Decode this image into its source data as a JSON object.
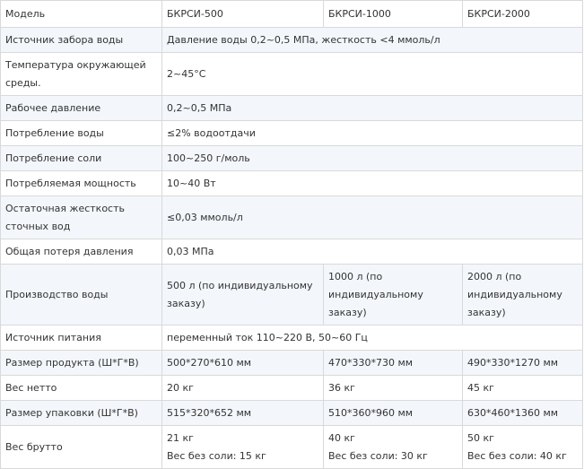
{
  "header": {
    "label": "Модель",
    "models": [
      "БКРСИ-500",
      "БКРСИ-1000",
      "БКРСИ-2000"
    ]
  },
  "rows": {
    "water_source": {
      "label": "Источник забора воды",
      "value": "Давление воды 0,2~0,5 МПа, жесткость <4 ммоль/л"
    },
    "ambient_temp": {
      "label": "Температура окружающей среды.",
      "value": "2~45°C"
    },
    "working_pressure": {
      "label": "Рабочее давление",
      "value": "0,2~0,5 МПа"
    },
    "water_consumption": {
      "label": "Потребление воды",
      "value": "≤2% водоотдачи"
    },
    "salt_consumption": {
      "label": "Потребление соли",
      "value": "100~250 г/моль"
    },
    "power_consumption": {
      "label": "Потребляемая мощность",
      "value": "10~40 Вт"
    },
    "residual_hardness": {
      "label": "Остаточная жесткость сточных вод",
      "value": "≤0,03 ммоль/л"
    },
    "pressure_loss": {
      "label": "Общая потеря давления",
      "value": "0,03 МПа"
    },
    "productivity": {
      "label": "Производство воды",
      "values": [
        "500 л (по индивидуальному заказу)",
        "1000 л (по индивидуальному заказу)",
        "2000 л (по индивидуальному заказу)"
      ]
    },
    "power_supply": {
      "label": "Источник питания",
      "value": "переменный ток 110~220 В, 50~60 Гц"
    },
    "product_size": {
      "label": "Размер продукта (Ш*Г*В)",
      "values": [
        "500*270*610 мм",
        "470*330*730 мм",
        "490*330*1270 мм"
      ]
    },
    "net_weight": {
      "label": "Вес нетто",
      "values": [
        "20 кг",
        "36 кг",
        "45 кг"
      ]
    },
    "package_size": {
      "label": "Размер упаковки (Ш*Г*В)",
      "values": [
        "515*320*652 мм",
        "510*360*960 мм",
        "630*460*1360 мм"
      ]
    },
    "gross_weight": {
      "label": "Вес брутто",
      "values": [
        {
          "gross": "21 кг",
          "no_salt": "Вес без соли: 15 кг"
        },
        {
          "gross": "40 кг",
          "no_salt": "Вес без соли: 30 кг"
        },
        {
          "gross": "50 кг",
          "no_salt": "Вес без соли: 40 кг"
        }
      ]
    }
  }
}
